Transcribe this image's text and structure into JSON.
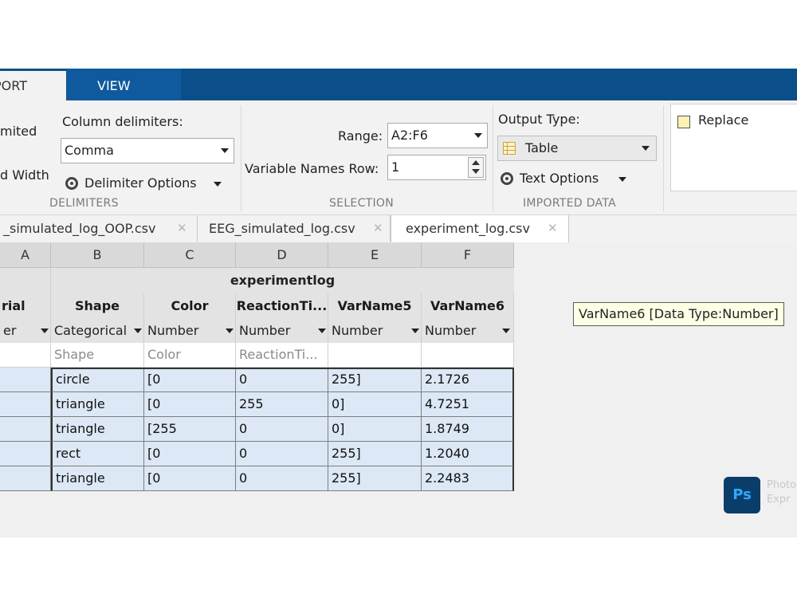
{
  "ribbon": {
    "tabs": [
      "PORT",
      "VIEW"
    ],
    "delimited_label": "mited",
    "fixed_width_label": "d Width",
    "column_delimiters_label": "Column delimiters:",
    "delimiter_value": "Comma",
    "delimiter_options_label": "Delimiter Options",
    "delimiters_group": "DELIMITERS",
    "range_label": "Range:",
    "range_value": "A2:F6",
    "varnames_row_label": "Variable Names Row:",
    "varnames_row_value": "1",
    "selection_group": "SELECTION",
    "output_type_label": "Output Type:",
    "output_type_value": "Table",
    "text_options_label": "Text Options",
    "imported_data_group": "IMPORTED DATA",
    "replace_label": "Replace"
  },
  "file_tabs": [
    {
      "label": "_simulated_log_OOP.csv",
      "active": false
    },
    {
      "label": "EEG_simulated_log.csv",
      "active": false
    },
    {
      "label": "experiment_log.csv",
      "active": true
    }
  ],
  "sheet": {
    "column_letters": [
      "A",
      "B",
      "C",
      "D",
      "E",
      "F"
    ],
    "table_name": "experimentlog",
    "var_headers": [
      "rial",
      "Shape",
      "Color",
      "ReactionTi...",
      "VarName5",
      "VarName6"
    ],
    "types": [
      "er",
      "Categorical",
      "Number",
      "Number",
      "Number",
      "Number"
    ],
    "var_names": [
      "",
      "Shape",
      "Color",
      "ReactionTi...",
      "",
      ""
    ],
    "rows": [
      [
        "",
        "circle",
        "[0",
        "0",
        "255]",
        "2.1726"
      ],
      [
        "",
        "triangle",
        "[0",
        "255",
        "0]",
        "4.7251"
      ],
      [
        "",
        "triangle",
        "[255",
        "0",
        "0]",
        "1.8749"
      ],
      [
        "",
        "rect",
        "[0",
        "0",
        "255]",
        "1.2040"
      ],
      [
        "",
        "triangle",
        "[0",
        "0",
        "255]",
        "2.2483"
      ]
    ]
  },
  "tooltip": "VarName6 [Data Type:Number]",
  "badge": {
    "label": "Ps",
    "text_line1": "Photo",
    "text_line2": "Expr"
  },
  "colors": {
    "ribbon_blue": "#0b4f8a",
    "selection_fill": "#dce8f5",
    "tooltip_bg": "#ffffe6"
  }
}
